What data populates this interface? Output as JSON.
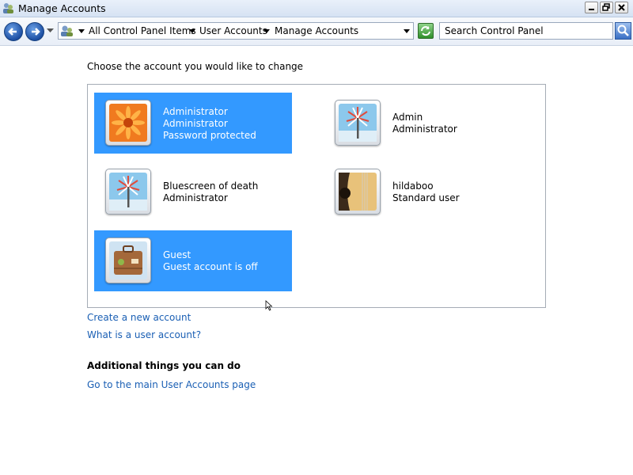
{
  "window": {
    "title": "Manage Accounts"
  },
  "navbar": {
    "breadcrumbs": [
      "All Control Panel Items",
      "User Accounts",
      "Manage Accounts"
    ],
    "search_placeholder": "Search Control Panel"
  },
  "main": {
    "heading": "Choose the account you would like to change",
    "accounts": [
      {
        "name": "Administrator",
        "type": "Administrator",
        "status": "Password protected",
        "selected": true,
        "picture": "orange-flower"
      },
      {
        "name": "Admin",
        "type": "Administrator",
        "selected": false,
        "picture": "pinwheel"
      },
      {
        "name": "Bluescreen of death",
        "type": "Administrator",
        "selected": false,
        "picture": "pinwheel"
      },
      {
        "name": "hildaboo",
        "type": "Standard user",
        "selected": false,
        "picture": "guitar"
      },
      {
        "name": "Guest",
        "type": "Guest account is off",
        "selected": true,
        "picture": "suitcase"
      }
    ],
    "links": {
      "create": "Create a new account",
      "what_is": "What is a user account?"
    },
    "additional_heading": "Additional things you can do",
    "additional_links": [
      "Go to the main User Accounts page"
    ]
  },
  "colors": {
    "selection": "#3399ff",
    "link": "#1a5fb4"
  }
}
